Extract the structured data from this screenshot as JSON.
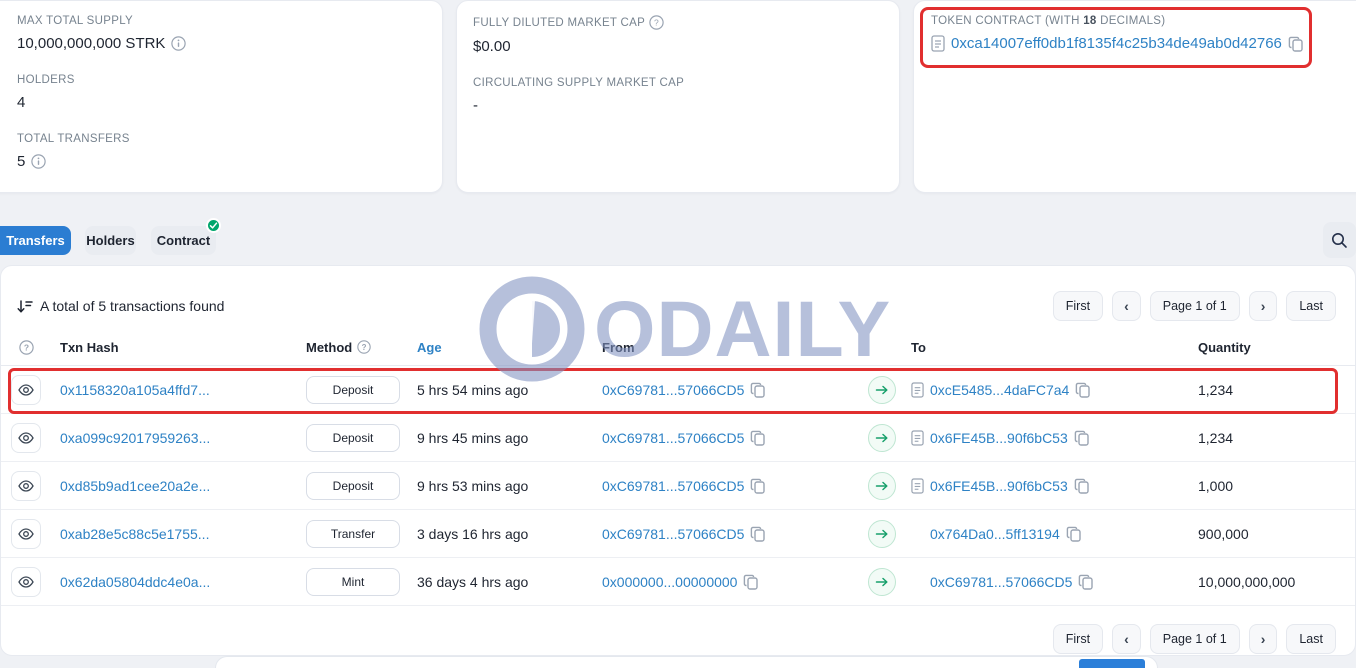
{
  "colors": {
    "link_blue": "#2e82c5",
    "tab_active_blue": "#2b7dd2",
    "annotation_red": "#e12f2f",
    "verified_green": "#00a66c",
    "arrow_green": "#17a06b"
  },
  "summary": {
    "max_total_supply": {
      "label": "MAX TOTAL SUPPLY",
      "value": "10,000,000,000 STRK"
    },
    "holders": {
      "label": "HOLDERS",
      "value": "4"
    },
    "total_transfers": {
      "label": "TOTAL TRANSFERS",
      "value": "5"
    },
    "fully_diluted_market_cap": {
      "label": "FULLY DILUTED MARKET CAP",
      "value": "$0.00"
    },
    "circulating_supply_market_cap": {
      "label": "CIRCULATING SUPPLY MARKET CAP",
      "value": "-"
    },
    "token_contract": {
      "label_pre": "TOKEN CONTRACT (WITH ",
      "label_bold": "18",
      "label_post": " DECIMALS)",
      "address": "0xca14007eff0db1f8135f4c25b34de49ab0d42766"
    }
  },
  "tabs": {
    "transfers": "Transfers",
    "holders": "Holders",
    "contract": "Contract"
  },
  "transfers_panel": {
    "total_text": "A total of 5 transactions found",
    "pagination": {
      "first": "First",
      "prev": "‹",
      "page": "Page 1 of 1",
      "next": "›",
      "last": "Last"
    },
    "columns": {
      "txn_hash": "Txn Hash",
      "method": "Method",
      "age": "Age",
      "from": "From",
      "to": "To",
      "quantity": "Quantity"
    }
  },
  "table": {
    "rows": [
      {
        "hash": "0x1158320a105a4ffd7...",
        "method": "Deposit",
        "age": "5 hrs 54 mins ago",
        "from": "0xC69781...57066CD5",
        "to": "0xcE5485...4daFC7a4",
        "to_is_contract": true,
        "quantity": "1,234"
      },
      {
        "hash": "0xa099c92017959263...",
        "method": "Deposit",
        "age": "9 hrs 45 mins ago",
        "from": "0xC69781...57066CD5",
        "to": "0x6FE45B...90f6bC53",
        "to_is_contract": true,
        "quantity": "1,234"
      },
      {
        "hash": "0xd85b9ad1cee20a2e...",
        "method": "Deposit",
        "age": "9 hrs 53 mins ago",
        "from": "0xC69781...57066CD5",
        "to": "0x6FE45B...90f6bC53",
        "to_is_contract": true,
        "quantity": "1,000"
      },
      {
        "hash": "0xab28e5c88c5e1755...",
        "method": "Transfer",
        "age": "3 days 16 hrs ago",
        "from": "0xC69781...57066CD5",
        "to": "0x764Da0...5ff13194",
        "to_is_contract": false,
        "quantity": "900,000"
      },
      {
        "hash": "0x62da05804ddc4e0a...",
        "method": "Mint",
        "age": "36 days 4 hrs ago",
        "from": "0x000000...00000000",
        "to": "0xC69781...57066CD5",
        "to_is_contract": false,
        "quantity": "10,000,000,000"
      }
    ]
  },
  "watermark": {
    "text": "ODAILY"
  }
}
